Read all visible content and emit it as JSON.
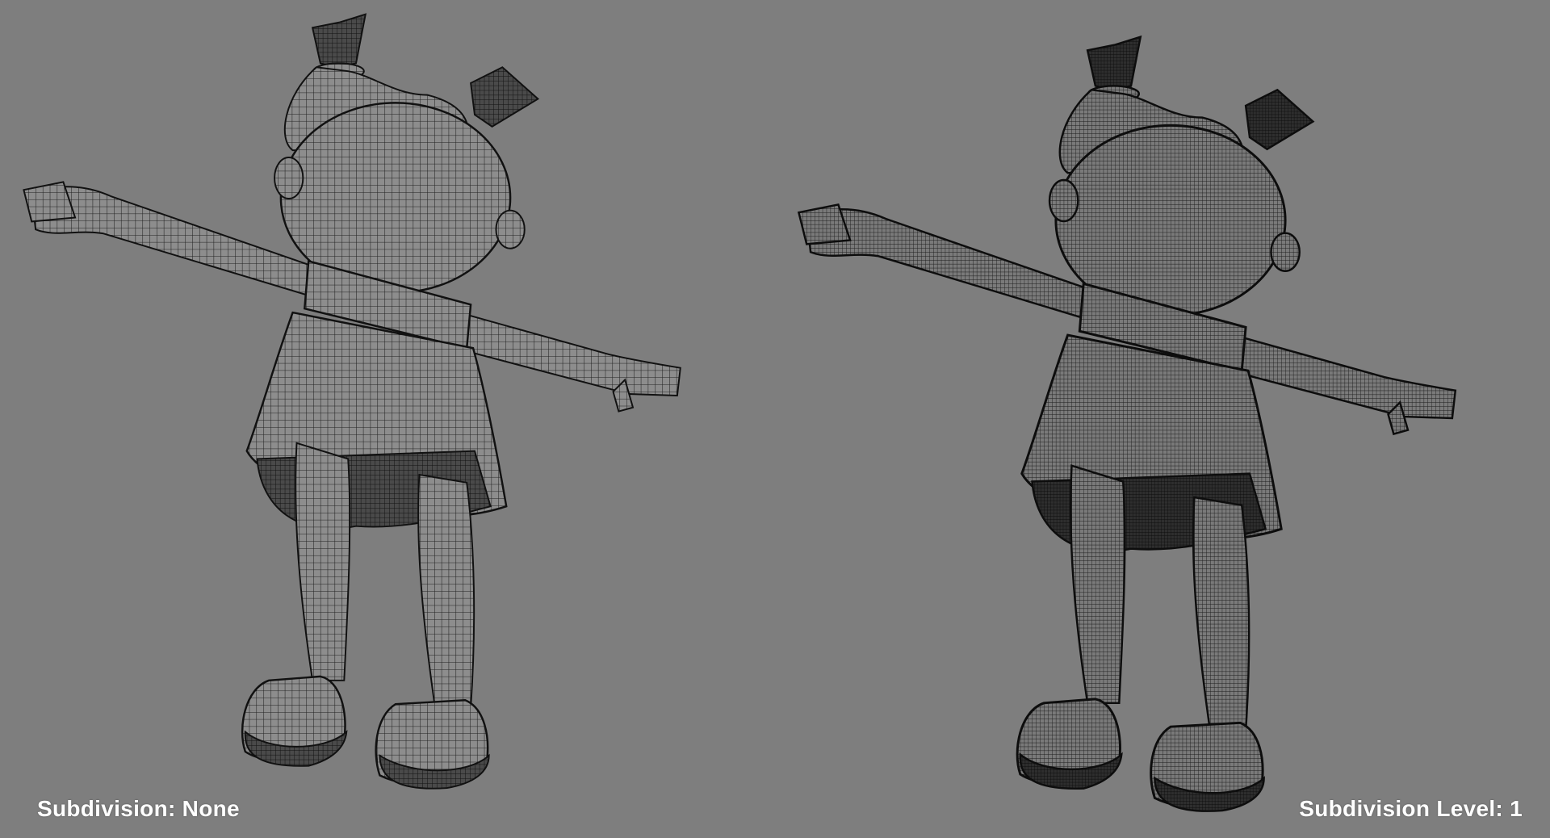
{
  "viewport": {
    "background_color": "#7e7e7e",
    "wire_color": "#1a1a1a",
    "mesh_fill": "#8a8a8a"
  },
  "panels": [
    {
      "id": "subdivision-none",
      "caption": "Subdivision: None",
      "mesh_density": "low"
    },
    {
      "id": "subdivision-level-1",
      "caption": "Subdivision Level: 1",
      "mesh_density": "high"
    }
  ]
}
